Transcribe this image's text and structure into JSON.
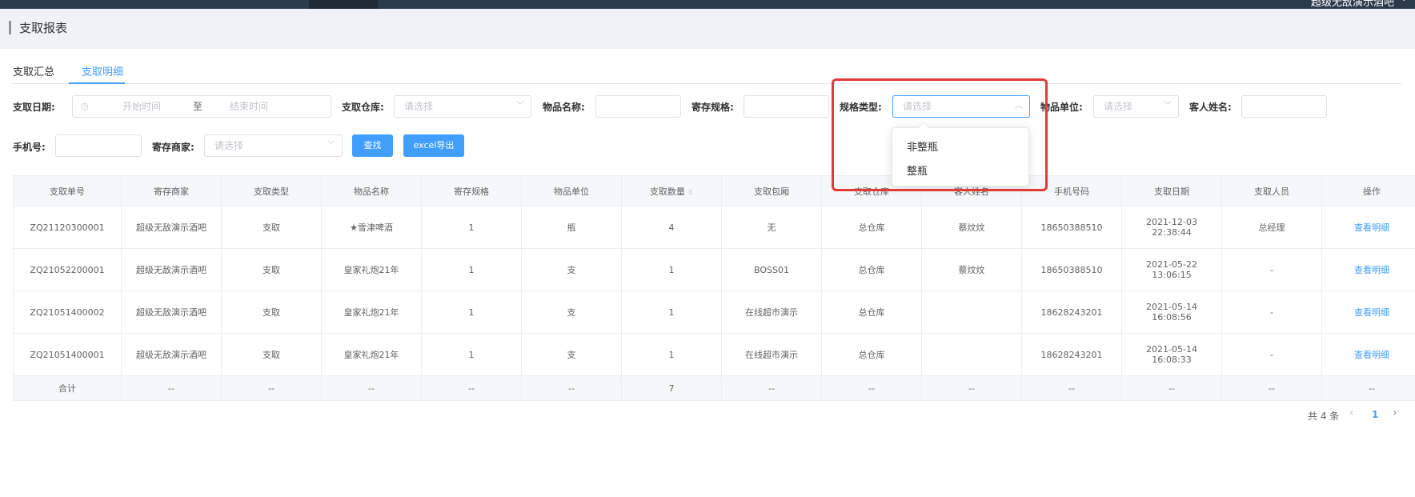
{
  "topbar": {
    "user": "超级无敌演示酒吧",
    "user_caret": "⌄"
  },
  "page": {
    "title": "支取报表"
  },
  "tabs": [
    {
      "label": "支取汇总"
    },
    {
      "label": "支取明细"
    }
  ],
  "filters": {
    "date": {
      "label": "支取日期:",
      "start_placeholder": "开始时间",
      "separator": "至",
      "end_placeholder": "结束时间",
      "icon": "clock-icon"
    },
    "warehouse": {
      "label": "支取仓库:",
      "placeholder": "请选择"
    },
    "item_name": {
      "label": "物品名称:"
    },
    "spec": {
      "label": "寄存规格:"
    },
    "spec_type": {
      "label": "规格类型:",
      "placeholder": "请选择",
      "open": true
    },
    "unit": {
      "label": "物品单位:",
      "placeholder": "请选择"
    },
    "guest_name": {
      "label": "客人姓名:"
    },
    "phone": {
      "label": "手机号:"
    },
    "merchant": {
      "label": "寄存商家:",
      "placeholder": "请选择"
    },
    "search_button": "查找",
    "export_button": "excel导出"
  },
  "dropdown_options": [
    "非整瓶",
    "整瓶"
  ],
  "table": {
    "headers": [
      "支取单号",
      "寄存商家",
      "支取类型",
      "物品名称",
      "寄存规格",
      "物品单位",
      "支取数量",
      "支取包厢",
      "支取仓库",
      "客人姓名",
      "手机号码",
      "支取日期",
      "支取人员",
      "操作"
    ],
    "rows": [
      [
        "ZQ21120300001",
        "超级无敌演示酒吧",
        "支取",
        "★雪津啤酒",
        "1",
        "瓶",
        "4",
        "无",
        "总仓库",
        "蔡炆炆",
        "18650388510",
        "2021-12-03 22:38:44",
        "总经理",
        "查看明细"
      ],
      [
        "ZQ21052200001",
        "超级无敌演示酒吧",
        "支取",
        "皇家礼炮21年",
        "1",
        "支",
        "1",
        "BOSS01",
        "总仓库",
        "蔡炆炆",
        "18650388510",
        "2021-05-22 13:06:15",
        "-",
        "查看明细"
      ],
      [
        "ZQ21051400002",
        "超级无敌演示酒吧",
        "支取",
        "皇家礼炮21年",
        "1",
        "支",
        "1",
        "在线超市演示",
        "总仓库",
        "",
        "18628243201",
        "2021-05-14 16:08:56",
        "-",
        "查看明细"
      ],
      [
        "ZQ21051400001",
        "超级无敌演示酒吧",
        "支取",
        "皇家礼炮21年",
        "1",
        "支",
        "1",
        "在线超市演示",
        "总仓库",
        "",
        "18628243201",
        "2021-05-14 16:08:33",
        "-",
        "查看明细"
      ]
    ],
    "summary": [
      "合计",
      "--",
      "--",
      "--",
      "--",
      "--",
      "7",
      "--",
      "--",
      "--",
      "--",
      "--",
      "--",
      "--"
    ]
  },
  "pagination": {
    "total": "共 4 条",
    "prev": "‹",
    "page": "1",
    "next": "›"
  },
  "colors": {
    "accent": "#409eff",
    "highlight": "#e53935"
  }
}
